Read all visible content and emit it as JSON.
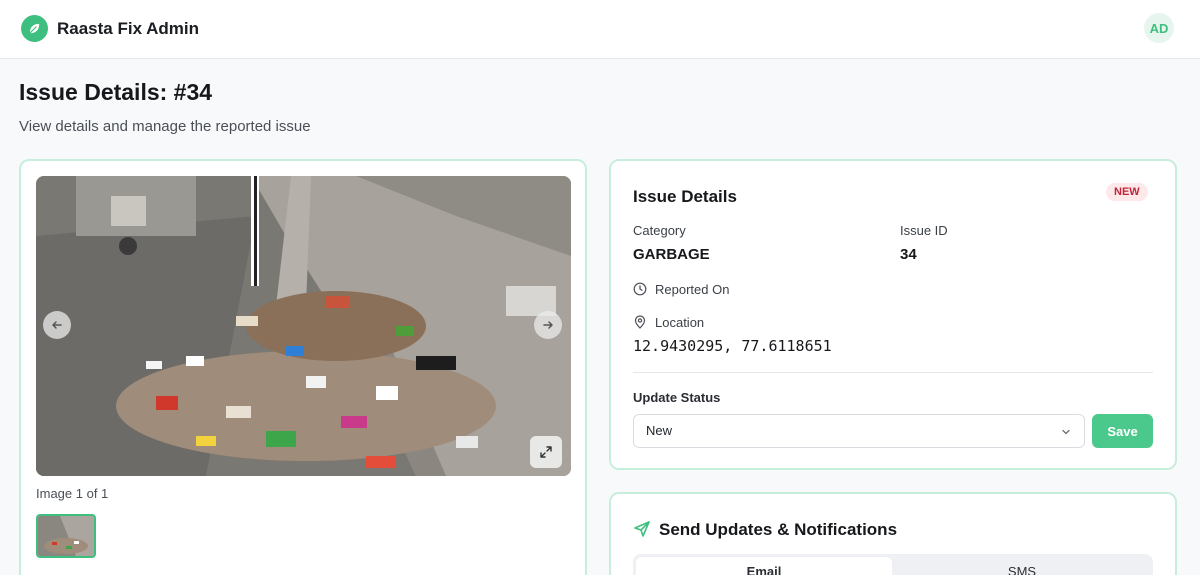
{
  "app": {
    "title": "Raasta Fix Admin",
    "user_initials": "AD"
  },
  "page": {
    "title": "Issue Details: #34",
    "subtitle": "View details and manage the reported issue"
  },
  "gallery": {
    "counter": "Image 1 of 1"
  },
  "details": {
    "heading": "Issue Details",
    "badge": "NEW",
    "category_label": "Category",
    "category_value": "GARBAGE",
    "issue_id_label": "Issue ID",
    "issue_id_value": "34",
    "reported_label": "Reported On",
    "location_label": "Location",
    "coordinates": "12.9430295, 77.6118651",
    "status_label": "Update Status",
    "status_value": "New",
    "save_label": "Save"
  },
  "notifications": {
    "heading": "Send Updates & Notifications",
    "tabs": [
      "Email",
      "SMS"
    ]
  },
  "colors": {
    "accent": "#3fbf7f",
    "badge_bg": "#fde8ea",
    "badge_text": "#c0263a"
  },
  "icons": [
    "leaf-icon",
    "arrow-left-icon",
    "arrow-right-icon",
    "expand-icon",
    "clock-icon",
    "map-pin-icon",
    "chevron-down-icon",
    "send-icon"
  ]
}
